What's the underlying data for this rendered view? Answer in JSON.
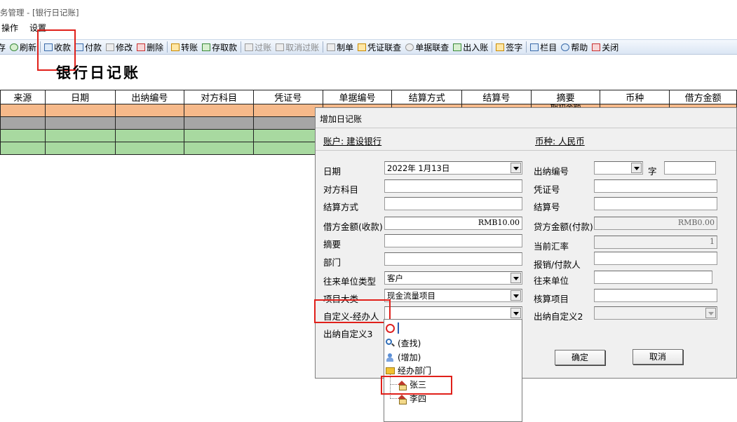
{
  "window": {
    "title": "务管理 - [银行日记账]"
  },
  "menu": {
    "items": [
      "操作",
      "设置"
    ]
  },
  "toolbar": {
    "items": [
      {
        "label": "存",
        "icon": "save-icon",
        "enabled": true
      },
      {
        "label": "刷新",
        "icon": "refresh-icon",
        "enabled": true
      },
      {
        "label": "收款",
        "icon": "receipt-icon",
        "enabled": true
      },
      {
        "label": "付款",
        "icon": "payment-icon",
        "enabled": true
      },
      {
        "label": "修改",
        "icon": "edit-icon",
        "enabled": true
      },
      {
        "label": "删除",
        "icon": "delete-icon",
        "enabled": true
      },
      {
        "label": "转账",
        "icon": "transfer-icon",
        "enabled": true
      },
      {
        "label": "存取款",
        "icon": "deposit-icon",
        "enabled": true
      },
      {
        "label": "过账",
        "icon": "post-icon",
        "enabled": false
      },
      {
        "label": "取消过账",
        "icon": "unpost-icon",
        "enabled": false
      },
      {
        "label": "制单",
        "icon": "voucher-make-icon",
        "enabled": true
      },
      {
        "label": "凭证联查",
        "icon": "voucher-query-icon",
        "enabled": true
      },
      {
        "label": "单据联查",
        "icon": "document-query-icon",
        "enabled": true
      },
      {
        "label": "出入账",
        "icon": "in-out-icon",
        "enabled": true
      },
      {
        "label": "签字",
        "icon": "sign-icon",
        "enabled": true
      },
      {
        "label": "栏目",
        "icon": "columns-icon",
        "enabled": true
      },
      {
        "label": "帮助",
        "icon": "help-icon",
        "enabled": true
      },
      {
        "label": "关闭",
        "icon": "close-icon",
        "enabled": true
      }
    ]
  },
  "page": {
    "heading": "银行日记账"
  },
  "ledger": {
    "columns": [
      "来源",
      "日期",
      "出纳编号",
      "对方科目",
      "凭证号",
      "单据编号",
      "结算方式",
      "结算号",
      "摘要",
      "币种",
      "借方金额"
    ],
    "first_row_summary": "期初余额"
  },
  "dialog": {
    "title": "增加日记账",
    "account": "账户: 建设银行",
    "currency": "币种: 人民币",
    "left_fields": [
      {
        "label": "日期",
        "value": "2022年 1月13日",
        "type": "dropdown"
      },
      {
        "label": "对方科目",
        "value": "",
        "type": "text"
      },
      {
        "label": "结算方式",
        "value": "",
        "type": "text"
      },
      {
        "label": "借方金额(收款)",
        "value": "RMB10.00",
        "type": "number"
      },
      {
        "label": "摘要",
        "value": "",
        "type": "text"
      },
      {
        "label": "部门",
        "value": "",
        "type": "text"
      },
      {
        "label": "往来单位类型",
        "value": "客户",
        "type": "dropdown"
      },
      {
        "label": "项目大类",
        "value": "现金流量项目",
        "type": "dropdown"
      },
      {
        "label": "自定义-经办人",
        "value": "",
        "type": "dropdown"
      },
      {
        "label": "出纳自定义3",
        "value": "",
        "type": "none"
      }
    ],
    "right_fields": [
      {
        "label": "出纳编号",
        "value": "",
        "suffix": "字",
        "type": "dropdown-pair"
      },
      {
        "label": "凭证号",
        "value": "",
        "type": "text"
      },
      {
        "label": "结算号",
        "value": "",
        "type": "text"
      },
      {
        "label": "贷方金额(付款)",
        "value": "RMB0.00",
        "type": "readonly"
      },
      {
        "label": "当前汇率",
        "value": "1",
        "type": "readonly"
      },
      {
        "label": "报销/付款人",
        "value": "",
        "type": "text"
      },
      {
        "label": "往来单位",
        "value": "",
        "type": "text"
      },
      {
        "label": "核算项目",
        "value": "",
        "type": "text"
      },
      {
        "label": "出纳自定义2",
        "value": "",
        "type": "readonly-dropdown"
      }
    ],
    "ok_label": "确定",
    "cancel_label": "取消"
  },
  "dropdown_list": {
    "items": [
      {
        "label": "",
        "icon": "clear-icon"
      },
      {
        "label": "(查找)",
        "icon": "search-icon"
      },
      {
        "label": "(增加)",
        "icon": "add-user-icon"
      },
      {
        "label": "经办部门",
        "icon": "folder-icon"
      },
      {
        "label": "张三",
        "icon": "house-icon"
      },
      {
        "label": "李四",
        "icon": "house-icon"
      }
    ]
  },
  "colors": {
    "highlight": "#e0201a",
    "row_orange": "#f6b98a",
    "row_gray": "#a6a6a6",
    "row_green": "#a8d9a0"
  }
}
